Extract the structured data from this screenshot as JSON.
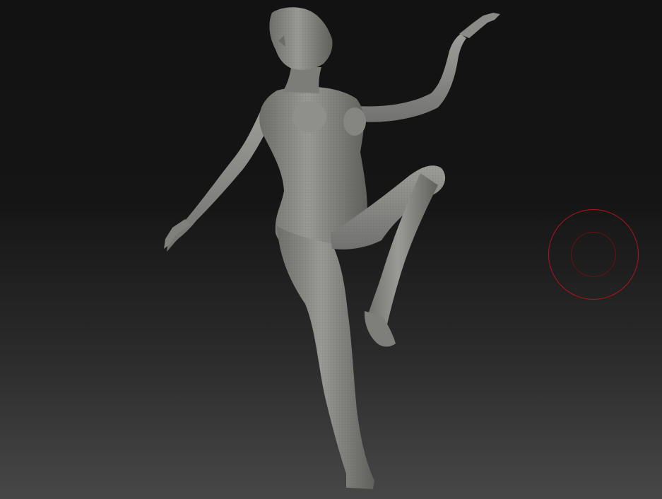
{
  "viewport": {
    "background_top": "#121212",
    "background_bottom": "#474747"
  },
  "model": {
    "kind": "sculpted-female-figure-mesh",
    "material_color": "#8c8d89",
    "wireframe_visible": true
  },
  "brush_cursor": {
    "outer_color": "#b3141a",
    "inner_color": "#6a1014"
  }
}
